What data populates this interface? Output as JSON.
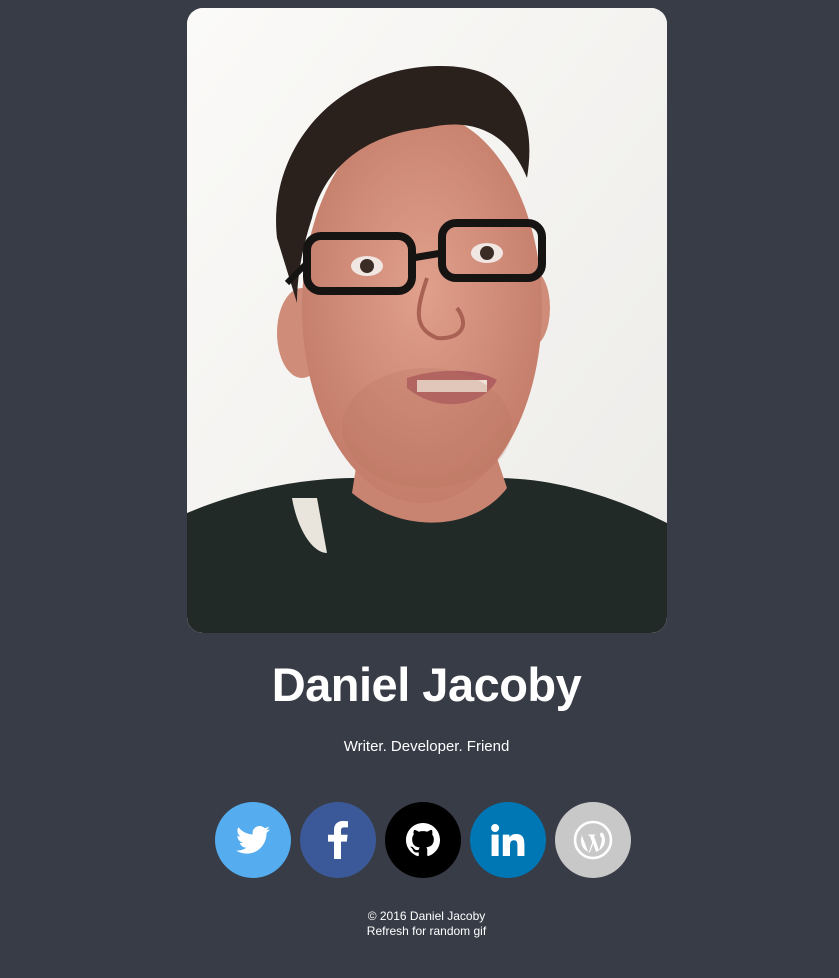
{
  "profile": {
    "photo_alt": "Daniel Jacoby",
    "name": "Daniel Jacoby",
    "tagline": "Writer. Developer. Friend"
  },
  "social": [
    {
      "name": "twitter",
      "icon": "twitter-icon",
      "color": "#55acee"
    },
    {
      "name": "facebook",
      "icon": "facebook-icon",
      "color": "#3b5998"
    },
    {
      "name": "github",
      "icon": "github-icon",
      "color": "#000000"
    },
    {
      "name": "linkedin",
      "icon": "linkedin-icon",
      "color": "#0077b5"
    },
    {
      "name": "wordpress",
      "icon": "wordpress-icon",
      "color": "#c8c8c8"
    }
  ],
  "footer": {
    "copyright": "© 2016 Daniel Jacoby",
    "refresh_note": "Refresh for random gif"
  },
  "colors": {
    "background": "#383c46",
    "text": "#ffffff"
  }
}
